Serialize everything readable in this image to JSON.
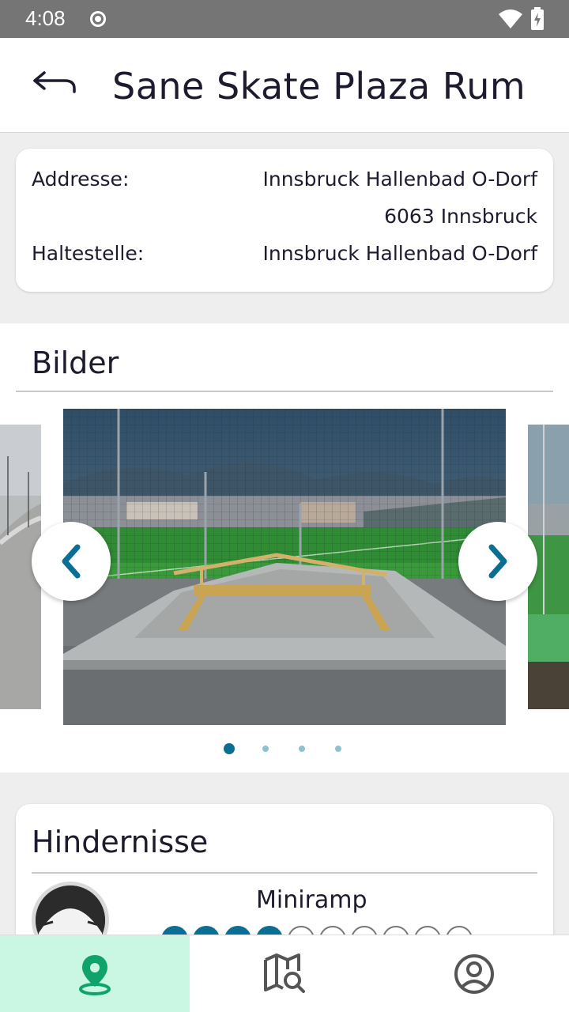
{
  "status_bar": {
    "time": "4:08"
  },
  "header": {
    "title": "Sane Skate Plaza Rum",
    "back_icon": "back-arrow-icon"
  },
  "address_card": {
    "address_label": "Addresse:",
    "address_line1": "Innsbruck Hallenbad O-Dorf",
    "address_line2": "6063 Innsbruck",
    "stop_label": "Haltestelle:",
    "stop_value": "Innsbruck Hallenbad O-Dorf"
  },
  "gallery": {
    "title": "Bilder",
    "image_count": 4,
    "active_index": 0,
    "prev_icon": "chevron-left-icon",
    "next_icon": "chevron-right-icon"
  },
  "obstacles": {
    "title": "Hindernisse",
    "items": [
      {
        "name": "Miniramp",
        "rating": 4,
        "rating_max": 10
      }
    ]
  },
  "bottom_nav": {
    "items": [
      {
        "icon": "location-pin-icon",
        "active": true
      },
      {
        "icon": "map-search-icon",
        "active": false
      },
      {
        "icon": "account-icon",
        "active": false
      }
    ]
  },
  "colors": {
    "accent": "#0b6e93",
    "nav_active_bg": "#c9f7e4",
    "nav_active_icon": "#0fa36b",
    "status_bar": "#757575"
  }
}
